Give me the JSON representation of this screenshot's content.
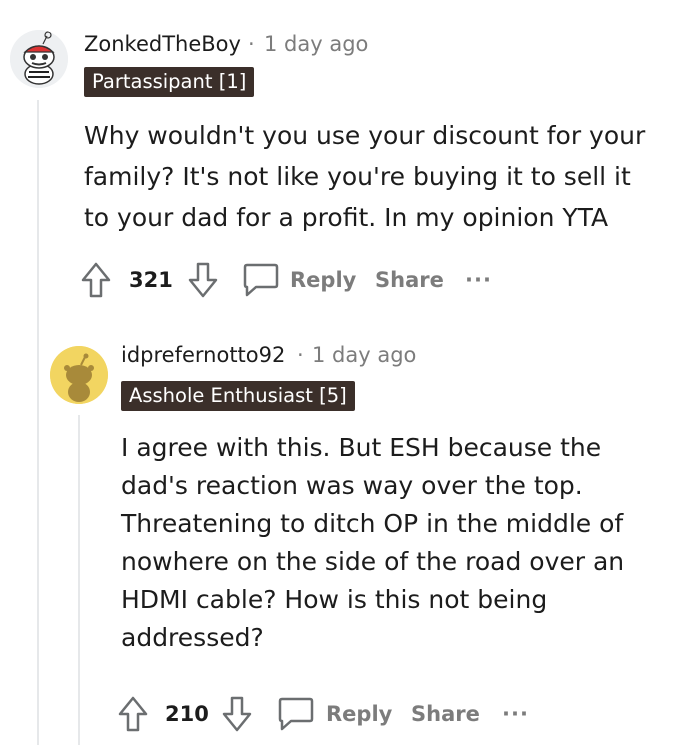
{
  "comments": [
    {
      "username": "ZonkedTheBoy",
      "separator": "·",
      "time": "1 day ago",
      "flair": "Partassipant [1]",
      "body_lines": [
        "Why wouldn't you use your discount for your",
        "family? It's not like you're buying it to sell it",
        "to your dad for a profit. In my opinion YTA"
      ],
      "votes": "321",
      "reply_label": "Reply",
      "share_label": "Share",
      "more_label": "···"
    },
    {
      "username": "idprefernotto92",
      "separator": "·",
      "time": "1 day ago",
      "flair": "Asshole Enthusiast [5]",
      "body_lines": [
        "I agree with this. But ESH because the",
        "dad's reaction was way over the top.",
        "Threatening to ditch OP in the middle of",
        "nowhere on the side of the road over an",
        "HDMI cable? How is this not being",
        "addressed?"
      ],
      "votes": "210",
      "reply_label": "Reply",
      "share_label": "Share",
      "more_label": "···"
    }
  ],
  "colors": {
    "flair_bg": "#3b2f2a",
    "meta_gray": "#7c7c7c",
    "thread_line": "#e6e8ea",
    "avatar2_bg": "#f2d561"
  }
}
